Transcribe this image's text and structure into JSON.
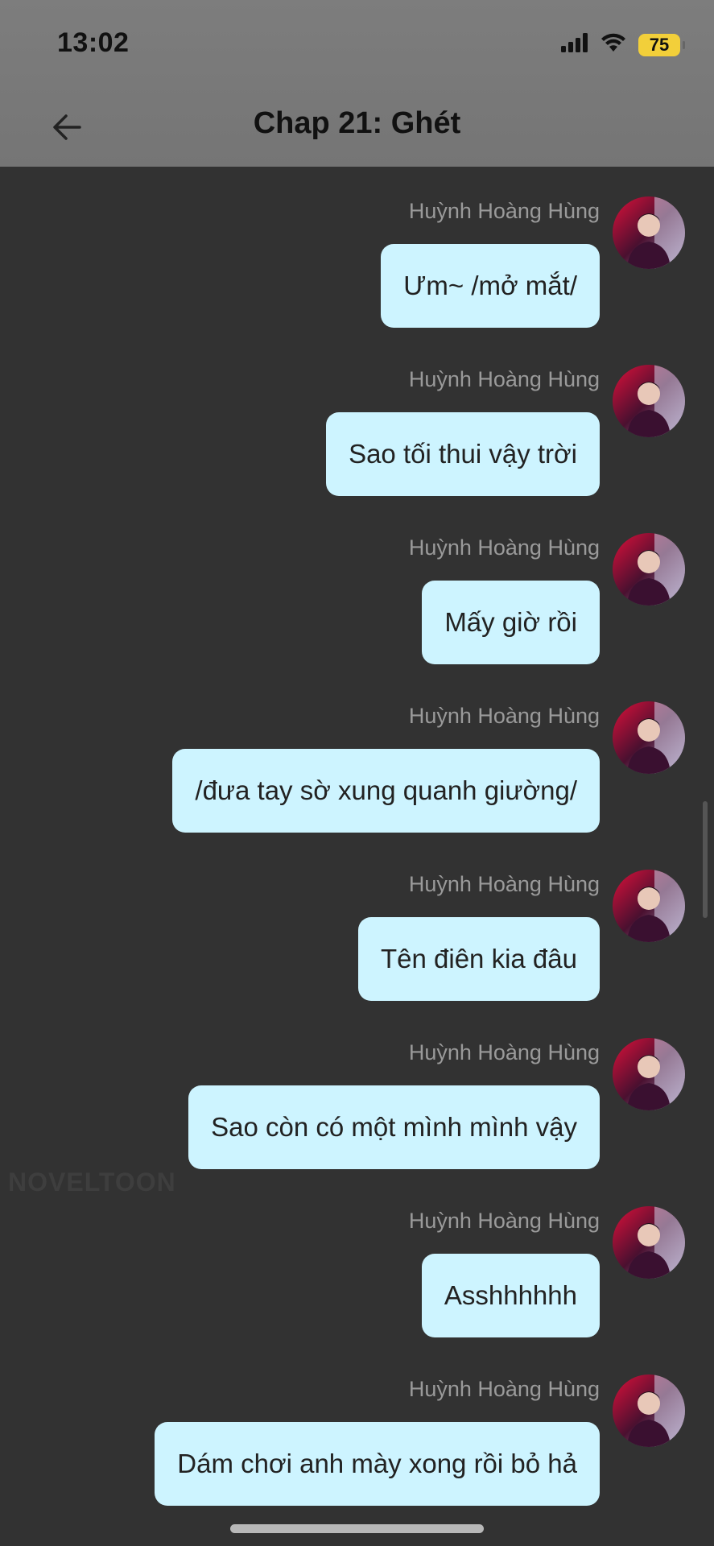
{
  "status_bar": {
    "time": "13:02",
    "battery": "75"
  },
  "header": {
    "title": "Chap 21: Ghét"
  },
  "messages": [
    {
      "sender": "Huỳnh Hoàng Hùng",
      "text": "Ưm~ /mở mắt/"
    },
    {
      "sender": "Huỳnh Hoàng Hùng",
      "text": "Sao tối thui vậy trời"
    },
    {
      "sender": "Huỳnh Hoàng Hùng",
      "text": "Mấy giờ rồi"
    },
    {
      "sender": "Huỳnh Hoàng Hùng",
      "text": "/đưa tay sờ xung quanh giường/"
    },
    {
      "sender": "Huỳnh Hoàng Hùng",
      "text": "Tên điên kia đâu"
    },
    {
      "sender": "Huỳnh Hoàng Hùng",
      "text": "Sao còn có một mình mình vậy"
    },
    {
      "sender": "Huỳnh Hoàng Hùng",
      "text": "Asshhhhhh"
    },
    {
      "sender": "Huỳnh Hoàng Hùng",
      "text": "Dám chơi anh mày xong rồi bỏ hả"
    }
  ],
  "watermark": "NOVELTOON",
  "colors": {
    "bubble": "#cdf4ff",
    "background": "#323232",
    "header": "#7a7a7a"
  }
}
